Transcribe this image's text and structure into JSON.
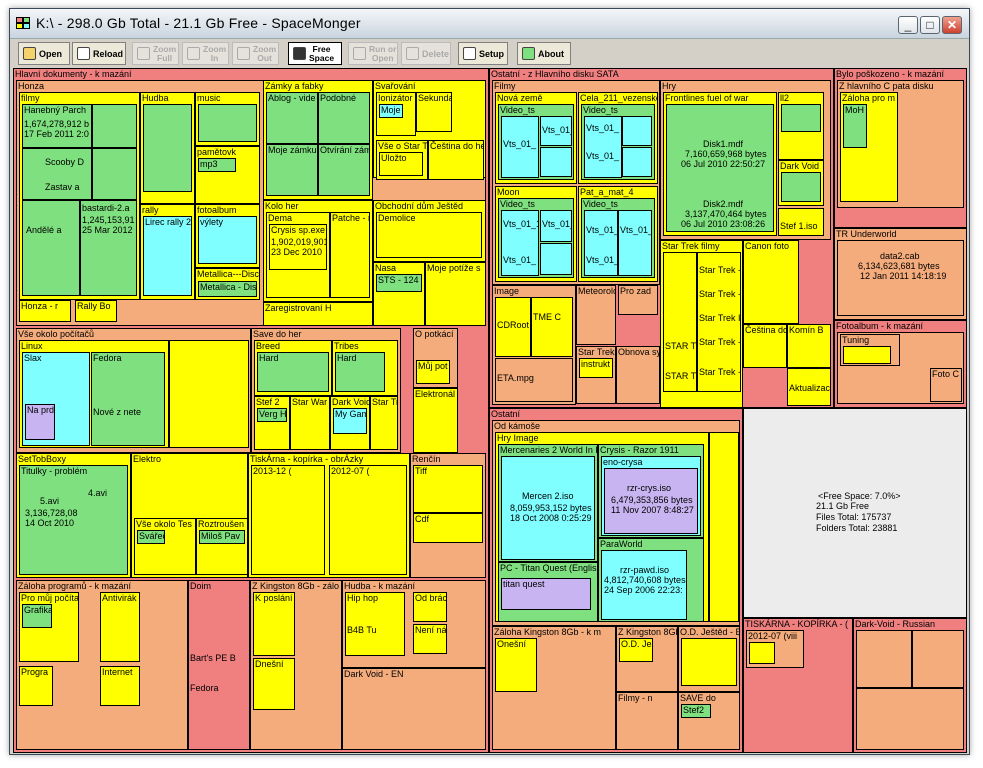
{
  "window": {
    "title": "K:\\  -  298.0 Gb Total  -  21.1 Gb Free  -  SpaceMonger",
    "min": "_",
    "max": "□",
    "close": "✕"
  },
  "toolbar": {
    "open": "Open",
    "reload": "Reload",
    "zoom_full": [
      "Zoom",
      "Full"
    ],
    "zoom_in": [
      "Zoom",
      "In"
    ],
    "zoom_out": [
      "Zoom",
      "Out"
    ],
    "free_space": [
      "Free",
      "Space"
    ],
    "run_open": [
      "Run or",
      "Open"
    ],
    "delete": "Delete",
    "setup": "Setup",
    "about": "About"
  },
  "colors": {
    "root": "#f07f7f",
    "folder": "#f4ac7c",
    "folder_l2": "#ffff00",
    "folder_l3": "#7fe07f",
    "folder_l4": "#7fffff",
    "folder_l5": "#c8b4f0",
    "free": "#ececec"
  },
  "labels": {
    "hd": "Hlavní dokumenty - k mazání",
    "honza": "Honza",
    "filmy": "filmy",
    "hanebny": "Hanebný Parch",
    "hanebny_sz": "1,674,278,912 b",
    "hanebny_dt": "17 Feb 2011  2:0",
    "scooby": "Scooby D",
    "zastav": "Zastav a",
    "bastardi": "bastardi-2.a",
    "bastardi_sz": "1,245,153,91",
    "bastardi_dt": "25 Mar 2012",
    "andele": "Andělé a",
    "hudba": "Hudba",
    "music": "music",
    "pametovky": "pamětovk",
    "mp3": "mp3",
    "rally": "rally",
    "lirec": "Lirec rally 2",
    "fotoalbum": "fotoalbum",
    "vylety": "výlety",
    "metallica1": "Metallica---Disc",
    "metallica2": "Metallica - Dis",
    "honza_r": "Honza - r",
    "rallybo": "Rally Bo",
    "zamky": "Zámky a fabky",
    "ablog": "Ablog - vide",
    "podobne": "Podobné",
    "moje_zamku": "Moje zámku",
    "otvirani": "Otvírání zám",
    "svarovani": "Svařování",
    "ionizator": "Ionizátor",
    "sekunda": "Sekunda",
    "moje": "Moje",
    "vse_star": "Vše o Star Tr",
    "cestiny": "Čeština do he",
    "ulozto": "Uložto",
    "kolo": "Kolo her",
    "dema": "Dema",
    "crysis": "Crysis sp.exe",
    "crysis_sz": "1,902,019,901 b",
    "crysis_dt": "23 Dec 2010",
    "patche": "Patche - na",
    "obchodni": "Obchodní dům Ještěd",
    "demolice": "Demolice",
    "nasa": "Nasa",
    "sts": "STS - 124",
    "moje_potize": "Moje potíže s",
    "zaregistrovani": "Zaregistrovaní H",
    "vse_pc": "Vše okolo počítačů",
    "linux": "Linux",
    "slax": "Slax",
    "fedora": "Fedora",
    "na_prd": "Na prd b",
    "nove_zn": "Nové z nete",
    "save": "Save do her",
    "breed": "Breed",
    "hard": "Hard",
    "tribes": "Tribes",
    "hard2": "Hard",
    "stef2": "Stef 2",
    "verg": "Verg Ha",
    "starwar": "Star War",
    "darkvoid": "Dark Void",
    "mygam": "My Gam",
    "startre": "Star Tre",
    "opotkani": "O potkácí",
    "mujpot": "Můj pot",
    "elektrona": "Elektronál",
    "settop": "SetTobBoxy",
    "titulky": "Titulky - problém",
    "s5avi": "5.avi",
    "s5avi_sz": "3,136,728,08",
    "s5avi_dt": "14 Oct 2010",
    "s4avi": "4.avi",
    "elektro": "Elektro",
    "vse_tes": "Vše okolo Tes",
    "svarec": "Svářeč",
    "roztrous": "Roztroušen",
    "milos": "Miloš Pav",
    "tiskarna": "TiskÁrna - kopírka - obrÁzky",
    "t2013": "2013-12 (",
    "t2012": "2012-07 (",
    "rencin": "Renčín",
    "tiff": "Tiff",
    "cdf": "Cdf",
    "zaloha_pr": "Záloha programů - k mazání",
    "pro_muj": "Pro můj počítač",
    "grafika": "Grafika",
    "antivir": "Antivirák",
    "program": "Progra",
    "internet": "Internet",
    "doim": "Doim",
    "barts": "Bart's PE B",
    "fedora2": "Fedora",
    "zkingston": "Z Kingston 8Gb - zálo",
    "kposlani": "K poslání",
    "dnesni": "Dnešní",
    "hudba_k": "Hudba - k mazání",
    "hiphop": "Hip hop",
    "odbrac": "Od brác",
    "b4b": "B4B Tu",
    "neni": "Není ná",
    "darkvoid_en": "Dark Void - EN",
    "ostatni_sata": "Ostatní - z Hlavního disku SATA",
    "filmy2": "Filmy",
    "nova_zeme": "Nová země",
    "video_ts": "Video_ts",
    "vts": "Vts_01_",
    "vts1": "Vts_01_1",
    "cela": "Cela_211_vezenské",
    "moon": "Moon",
    "pat": "Pat_a_mat_4",
    "hry": "Hry",
    "frontlines": "Frontlines fuel of war",
    "l2": "ll2",
    "disk1": "Disk1.mdf",
    "disk1_sz": "7,160,659,968 bytes",
    "disk1_dt": "06 Jul 2010   22:50:27",
    "disk2": "Disk2.mdf",
    "disk2_sz": "3,137,470,464 bytes",
    "disk2_dt": "06 Jul 2010   23:08:26",
    "darkvoid3": "Dark Void",
    "stef1": "Stef 1.iso",
    "startrek": "Star Trek filmy",
    "startrek_i": "Star Trek -",
    "startrek_ii": "Star Trek I",
    "star_tr": "STAR TR",
    "canon": "Canon foto",
    "cestiny_d": "Čeština do",
    "komin": "Komín B",
    "aktualiz": "Aktualizac",
    "image": "Image",
    "cdroot": "CDRoot",
    "tmec": "TME C",
    "eta": "ETA.mpg",
    "meteorol": "Meteorolo",
    "proza": "Pro zad",
    "startrek2": "Star Trek",
    "instrukt": "instrukt",
    "obnova": "Obnova sy",
    "bylo": "Bylo poškozeno - k mazání",
    "zhlavniho": "Z hlavního C pata disku",
    "zaloha_pro": "Záloha pro m",
    "moh": "MoH",
    "tr_under": "TR Underworld",
    "data2": "data2.cab",
    "data2_sz": "6,134,623,681 bytes",
    "data2_dt": "12 Jan 2011  14:18:19",
    "fotoalbum2": "Fotoalbum - k mazání",
    "tuning": "Tuning",
    "fotoc": "Foto C",
    "ostatni": "Ostatní",
    "odkamose": "Od kámoše",
    "hryimage": "Hry Image",
    "mercen": "Mercenaries 2 World In F",
    "mercen2": "Mercen 2.iso",
    "mercen_sz": "8,059,953,152 bytes",
    "mercen_dt": "18 Oct 2008   0:25:29",
    "crysis_r": "Crysis - Razor 1911",
    "eno": "eno-crysa",
    "rzr_crys": "rzr-crys.iso",
    "rzr_crys_sz": "6,479,353,856 bytes",
    "rzr_crys_dt": "11 Nov 2007   8:48:27",
    "paraworld": "ParaWorld",
    "rzr_pawd": "rzr-pawd.iso",
    "rzr_pawd_sz": "4,812,740,608 bytes",
    "rzr_pawd_dt": "24 Sep 2006   22:23:",
    "titan": "PC - Titan Quest (Englis",
    "titan2": "titan quest",
    "zaloha_k": "Záloha Kingston 8Gb - k m",
    "onesni": "Onešní",
    "zking2": "Z Kingston 8Gb",
    "od_jes": "O.D. Ješ",
    "od_jested": "O.D. Ještěd - E",
    "filmy_n": "Filmy - n",
    "save_do": "SAVE do",
    "stef2b": "Stef2",
    "free1": "<Free Space: 7.0%>",
    "free2": "21.1 Gb Free",
    "free3": "Files Total:  175737",
    "free4": "Folders Total:  23881",
    "tiskarna2": "TISKÁRNA - KOPÍRKA - (",
    "t2012b": "2012-07 (viii",
    "darkvoid_ru": "Dark-Void - Russian"
  }
}
